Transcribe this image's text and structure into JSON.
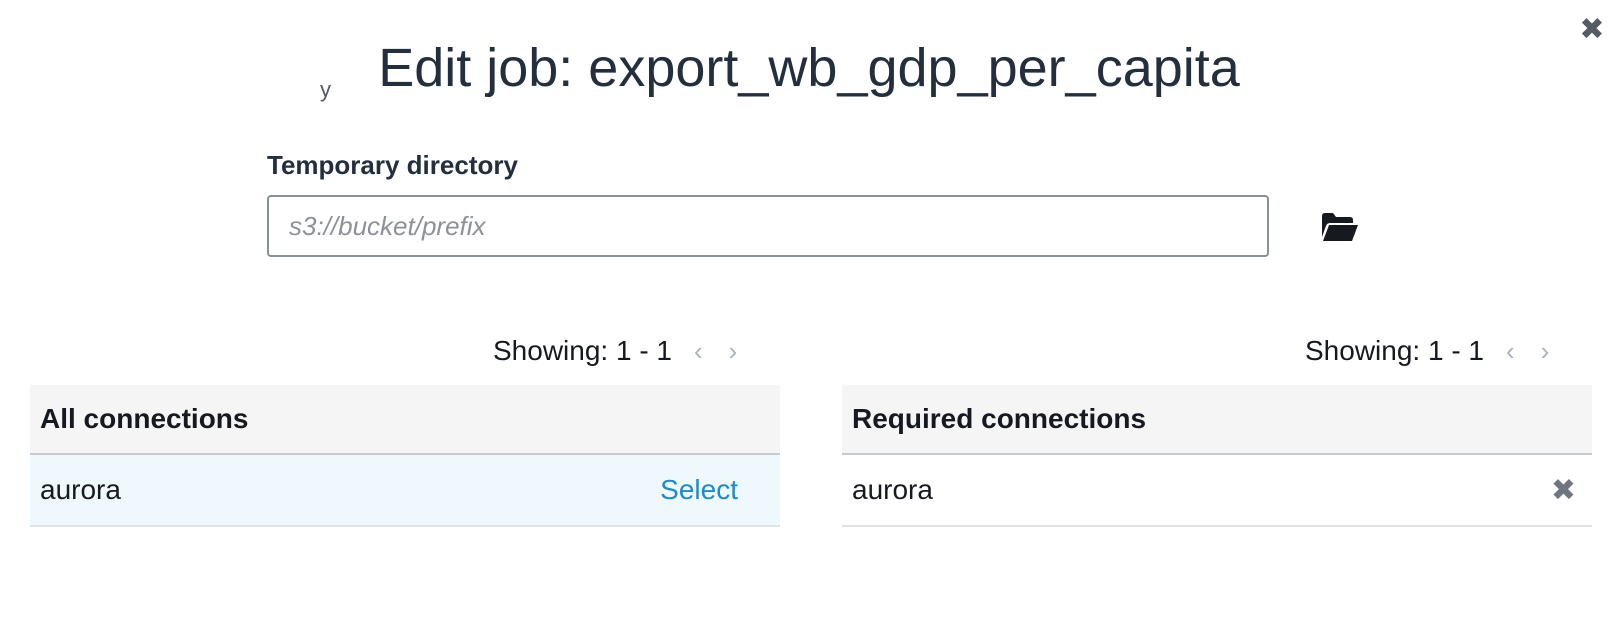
{
  "dialog": {
    "title": "Edit job: export_wb_gdp_per_capita",
    "close_icon": "close-icon",
    "stray_text": "y"
  },
  "temp_dir": {
    "label": "Temporary directory",
    "value": "",
    "placeholder": "s3://bucket/prefix",
    "browse_icon": "folder-open-icon"
  },
  "all_connections": {
    "pagination": {
      "text": "Showing: 1 - 1",
      "prev_icon": "chevron-left-icon",
      "next_icon": "chevron-right-icon"
    },
    "header": "All connections",
    "rows": [
      {
        "name": "aurora",
        "action": "Select"
      }
    ]
  },
  "required_connections": {
    "pagination": {
      "text": "Showing: 1 - 1",
      "prev_icon": "chevron-left-icon",
      "next_icon": "chevron-right-icon"
    },
    "header": "Required connections",
    "rows": [
      {
        "name": "aurora",
        "remove_icon": "remove-icon"
      }
    ]
  },
  "colors": {
    "link": "#1f8acb",
    "selected_row_bg": "#eff8fd",
    "header_bg": "#f5f5f5"
  }
}
